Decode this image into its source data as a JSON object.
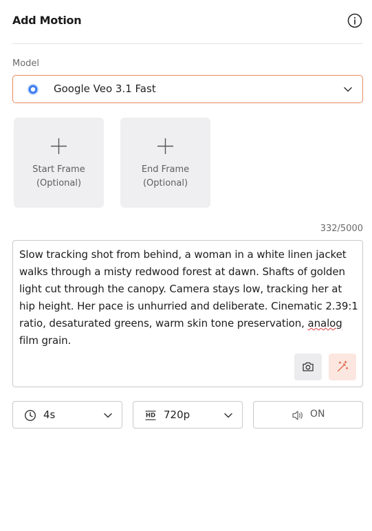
{
  "header": {
    "title": "Add Motion",
    "info_icon": "info-circle-icon"
  },
  "model": {
    "label": "Model",
    "selected": "Google Veo 3.1 Fast",
    "logo_icon": "google-veo-logo-icon",
    "accent_border": "#e9885a"
  },
  "frames": {
    "start": {
      "line1": "Start Frame",
      "line2": "(Optional)",
      "icon": "plus-icon"
    },
    "end": {
      "line1": "End Frame",
      "line2": "(Optional)",
      "icon": "plus-icon"
    }
  },
  "prompt": {
    "counter": "332/5000",
    "text_before": "Slow tracking shot from behind, a woman in a white linen jacket walks through a misty redwood forest at dawn. Shafts of golden light cut through the canopy. Camera stays low, tracking her at hip height. Her pace is unhurried and deliberate. Cinematic 2.39:1 ratio, desaturated greens, warm skin tone preservation, ",
    "text_misspelled": "analog",
    "text_after": " film grain.",
    "camera_icon": "camera-icon",
    "magic_icon": "magic-wand-icon"
  },
  "controls": {
    "duration": {
      "value": "4s",
      "icon": "clock-icon"
    },
    "resolution": {
      "value": "720p",
      "icon": "hd-icon"
    },
    "sound": {
      "value": "ON",
      "icon": "speaker-icon"
    }
  }
}
